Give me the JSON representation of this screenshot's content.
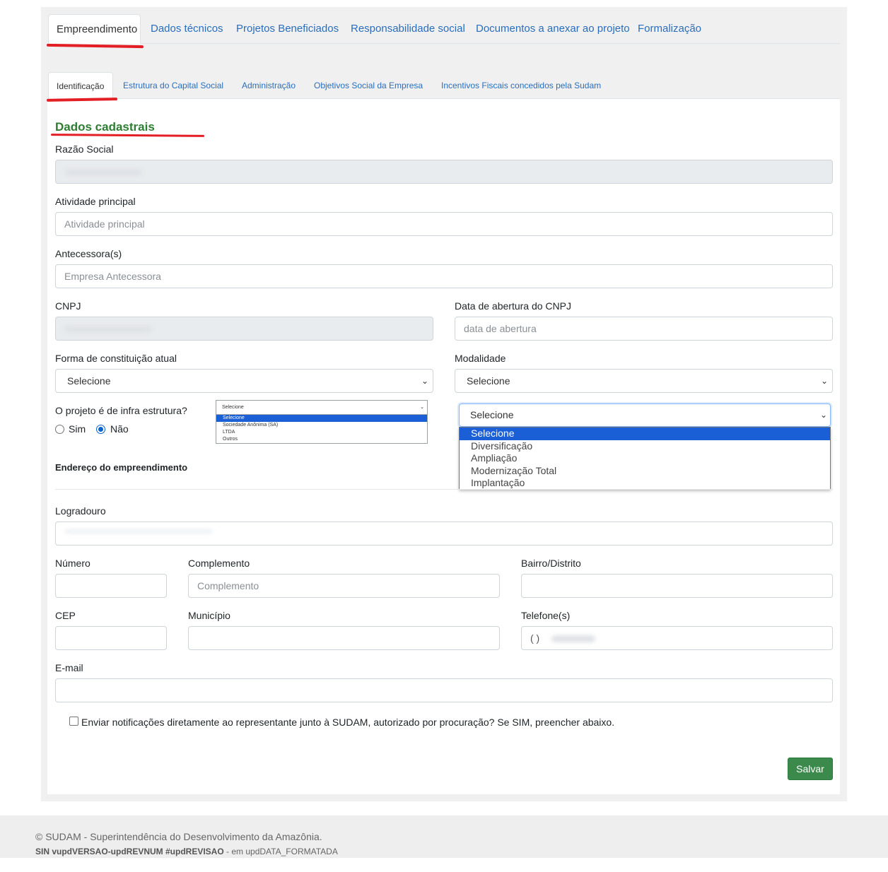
{
  "tabs": [
    {
      "label": "Empreendimento",
      "active": true
    },
    {
      "label": "Dados técnicos"
    },
    {
      "label": "Projetos Beneficiados"
    },
    {
      "label": "Responsabilidade social"
    },
    {
      "label": "Documentos a anexar ao projeto"
    },
    {
      "label": "Formalização"
    }
  ],
  "subtabs": [
    {
      "label": "Identificação",
      "active": true
    },
    {
      "label": "Estrutura do Capital Social"
    },
    {
      "label": "Administração"
    },
    {
      "label": "Objetivos Social da Empresa"
    },
    {
      "label": "Incentivos Fiscais concedidos pela Sudam"
    }
  ],
  "section_title": "Dados cadastrais",
  "form": {
    "razao_social": {
      "label": "Razão Social"
    },
    "atividade": {
      "label": "Atividade principal",
      "placeholder": "Atividade principal"
    },
    "antecessora": {
      "label": "Antecessora(s)",
      "placeholder": "Empresa Antecessora"
    },
    "cnpj": {
      "label": "CNPJ"
    },
    "data_abertura": {
      "label": "Data de abertura do CNPJ",
      "placeholder": "data de abertura"
    },
    "forma": {
      "label": "Forma de constituição atual",
      "value": "Selecione"
    },
    "modalidade": {
      "label": "Modalidade",
      "value": "Selecione"
    },
    "infra": {
      "label": "O projeto é de infra estrutura?",
      "sim": "Sim",
      "nao": "Não",
      "selected": "Não"
    },
    "endereco_title": "Endereço do empreendimento",
    "logradouro": {
      "label": "Logradouro"
    },
    "numero": {
      "label": "Número"
    },
    "complemento": {
      "label": "Complemento",
      "placeholder": "Complemento"
    },
    "bairro": {
      "label": "Bairro/Distrito"
    },
    "cep": {
      "label": "CEP"
    },
    "municipio": {
      "label": "Município"
    },
    "telefone": {
      "label": "Telefone(s)",
      "prefix": "(  )"
    },
    "email": {
      "label": "E-mail"
    },
    "notify_label": "Enviar notificações diretamente ao representante junto à SUDAM, autorizado por procuração? Se SIM, preencher abaixo."
  },
  "forma_dropdown": {
    "current": "Selecione",
    "options": [
      "Selecione",
      "Sociedade Anônima (SA)",
      "LTDA",
      "Outros"
    ],
    "highlighted": 0
  },
  "modalidade_dropdown": {
    "current": "Selecione",
    "options": [
      "Selecione",
      "Diversificação",
      "Ampliação",
      "Modernização Total",
      "Implantação"
    ],
    "highlighted": 0
  },
  "save_label": "Salvar",
  "footer": {
    "line1": "© SUDAM - Superintendência do Desenvolvimento da Amazônia.",
    "version": "SIN vupdVERSAO-updREVNUM #updREVISAO",
    "date": " - em updDATA_FORMATADA"
  },
  "colors": {
    "link": "#2a6ebb",
    "title_green": "#2e7d32",
    "annotation_red": "#e31e24",
    "save_green": "#3c8a4b"
  }
}
